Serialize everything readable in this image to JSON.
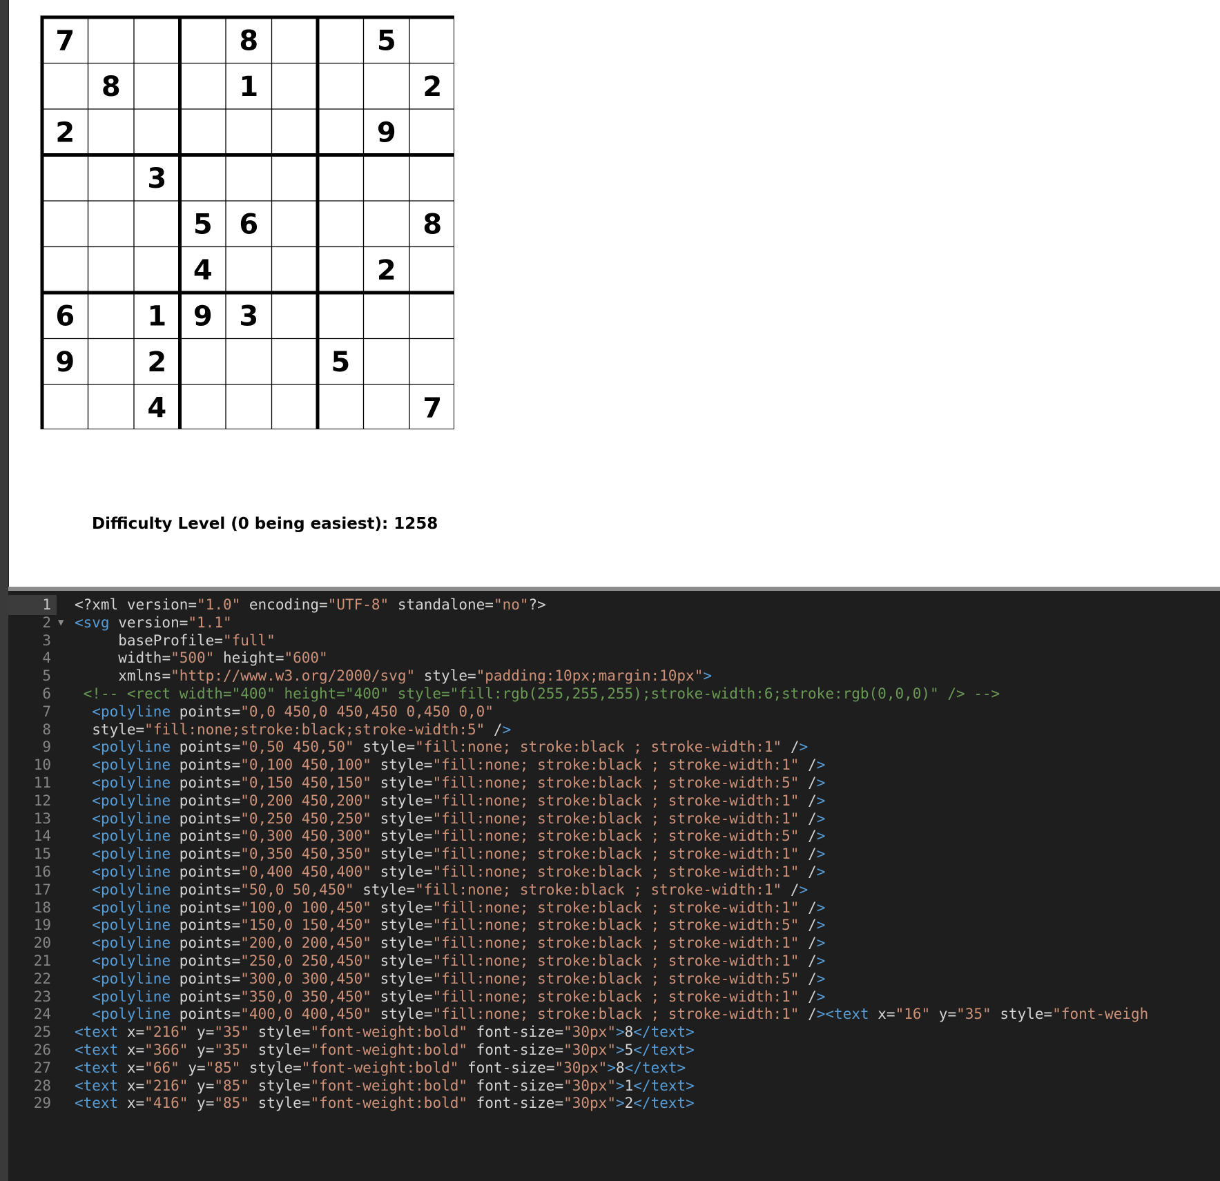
{
  "sudoku": {
    "grid": [
      [
        "7",
        "",
        "",
        "",
        "8",
        "",
        "",
        "5",
        ""
      ],
      [
        "",
        "8",
        "",
        "",
        "1",
        "",
        "",
        "",
        "2"
      ],
      [
        "2",
        "",
        "",
        "",
        "",
        "",
        "",
        "9",
        ""
      ],
      [
        "",
        "",
        "3",
        "",
        "",
        "",
        "",
        "",
        ""
      ],
      [
        "",
        "",
        "",
        "5",
        "6",
        "",
        "",
        "",
        "8"
      ],
      [
        "",
        "",
        "",
        "4",
        "",
        "",
        "",
        "2",
        ""
      ],
      [
        "6",
        "",
        "1",
        "9",
        "3",
        "",
        "",
        "",
        ""
      ],
      [
        "9",
        "",
        "2",
        "",
        "",
        "",
        "5",
        "",
        ""
      ],
      [
        "",
        "",
        "4",
        "",
        "",
        "",
        "",
        "",
        "7"
      ]
    ]
  },
  "difficulty": {
    "text": "Difficulty Level (0 being easiest): 1258"
  },
  "editor": {
    "active_line": 1,
    "folded_line": 2,
    "lines": [
      "<?xml version=\"1.0\" encoding=\"UTF-8\" standalone=\"no\"?>",
      "<svg version=\"1.1\"",
      "     baseProfile=\"full\"",
      "     width=\"500\" height=\"600\"",
      "     xmlns=\"http://www.w3.org/2000/svg\" style=\"padding:10px;margin:10px\">",
      " <!-- <rect width=\"400\" height=\"400\" style=\"fill:rgb(255,255,255);stroke-width:6;stroke:rgb(0,0,0)\" /> -->",
      "  <polyline points=\"0,0 450,0 450,450 0,450 0,0\"",
      "  style=\"fill:none;stroke:black;stroke-width:5\" />",
      "  <polyline points=\"0,50 450,50\" style=\"fill:none; stroke:black ; stroke-width:1\" />",
      "  <polyline points=\"0,100 450,100\" style=\"fill:none; stroke:black ; stroke-width:1\" />",
      "  <polyline points=\"0,150 450,150\" style=\"fill:none; stroke:black ; stroke-width:5\" />",
      "  <polyline points=\"0,200 450,200\" style=\"fill:none; stroke:black ; stroke-width:1\" />",
      "  <polyline points=\"0,250 450,250\" style=\"fill:none; stroke:black ; stroke-width:1\" />",
      "  <polyline points=\"0,300 450,300\" style=\"fill:none; stroke:black ; stroke-width:5\" />",
      "  <polyline points=\"0,350 450,350\" style=\"fill:none; stroke:black ; stroke-width:1\" />",
      "  <polyline points=\"0,400 450,400\" style=\"fill:none; stroke:black ; stroke-width:1\" />",
      "  <polyline points=\"50,0 50,450\" style=\"fill:none; stroke:black ; stroke-width:1\" />",
      "  <polyline points=\"100,0 100,450\" style=\"fill:none; stroke:black ; stroke-width:1\" />",
      "  <polyline points=\"150,0 150,450\" style=\"fill:none; stroke:black ; stroke-width:5\" />",
      "  <polyline points=\"200,0 200,450\" style=\"fill:none; stroke:black ; stroke-width:1\" />",
      "  <polyline points=\"250,0 250,450\" style=\"fill:none; stroke:black ; stroke-width:1\" />",
      "  <polyline points=\"300,0 300,450\" style=\"fill:none; stroke:black ; stroke-width:5\" />",
      "  <polyline points=\"350,0 350,450\" style=\"fill:none; stroke:black ; stroke-width:1\" />",
      "  <polyline points=\"400,0 400,450\" style=\"fill:none; stroke:black ; stroke-width:1\" /><text x=\"16\" y=\"35\" style=\"font-weigh",
      "<text x=\"216\" y=\"35\" style=\"font-weight:bold\" font-size=\"30px\">8</text>",
      "<text x=\"366\" y=\"35\" style=\"font-weight:bold\" font-size=\"30px\">5</text>",
      "<text x=\"66\" y=\"85\" style=\"font-weight:bold\" font-size=\"30px\">8</text>",
      "<text x=\"216\" y=\"85\" style=\"font-weight:bold\" font-size=\"30px\">1</text>",
      "<text x=\"416\" y=\"85\" style=\"font-weight:bold\" font-size=\"30px\">2</text>"
    ]
  },
  "colors": {
    "editor_bg": "#1e1e1e",
    "tag": "#569cd6",
    "attribute": "#9cdcfe",
    "string": "#ce9178",
    "comment": "#6a9955",
    "line_number": "#858585"
  }
}
